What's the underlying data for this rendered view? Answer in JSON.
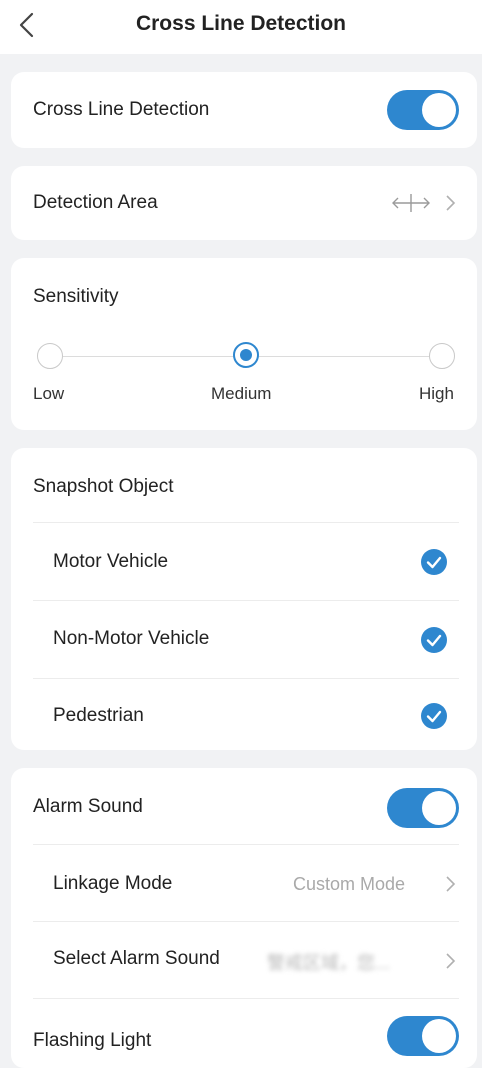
{
  "header": {
    "title": "Cross Line Detection",
    "back_icon": "chevron-left-icon"
  },
  "detection": {
    "label": "Cross Line Detection",
    "enabled": true
  },
  "area": {
    "label": "Detection Area",
    "icon": "cross-line-arrows-icon"
  },
  "sensitivity": {
    "title": "Sensitivity",
    "options": [
      "Low",
      "Medium",
      "High"
    ],
    "selected": "Medium"
  },
  "snapshot": {
    "title": "Snapshot Object",
    "items": [
      {
        "label": "Motor Vehicle",
        "checked": true
      },
      {
        "label": "Non-Motor Vehicle",
        "checked": true
      },
      {
        "label": "Pedestrian",
        "checked": true
      }
    ]
  },
  "alarm": {
    "label": "Alarm Sound",
    "enabled": true,
    "linkage_label": "Linkage Mode",
    "linkage_value": "Custom Mode",
    "select_label": "Select Alarm Sound",
    "select_value": "警戒区域，您...",
    "flashing_label": "Flashing Light",
    "flashing_enabled": true
  },
  "colors": {
    "accent": "#2e87cf",
    "background": "#f1f2f4",
    "card": "#ffffff"
  }
}
